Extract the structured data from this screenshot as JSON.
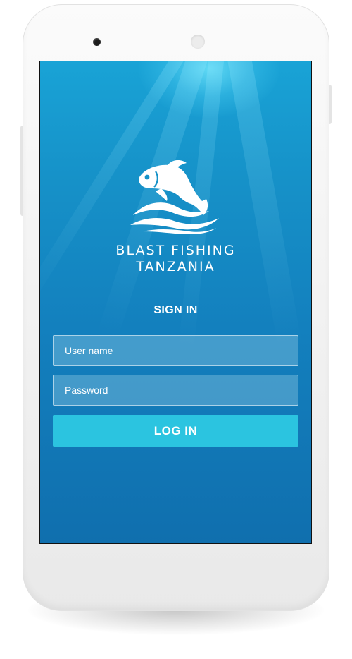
{
  "app": {
    "brand_line1": "BLAST FISHING",
    "brand_line2": "TANZANIA",
    "logo_icon": "fish-jumping-over-waves-icon"
  },
  "login": {
    "title": "SIGN IN",
    "username_placeholder": "User name",
    "username_value": "",
    "password_placeholder": "Password",
    "password_value": "",
    "submit_label": "LOG IN"
  },
  "colors": {
    "background_top": "#19a3d6",
    "background_bottom": "#106fae",
    "button": "#2bc4e0",
    "text": "#ffffff",
    "device_body": "#f3f3f3"
  }
}
